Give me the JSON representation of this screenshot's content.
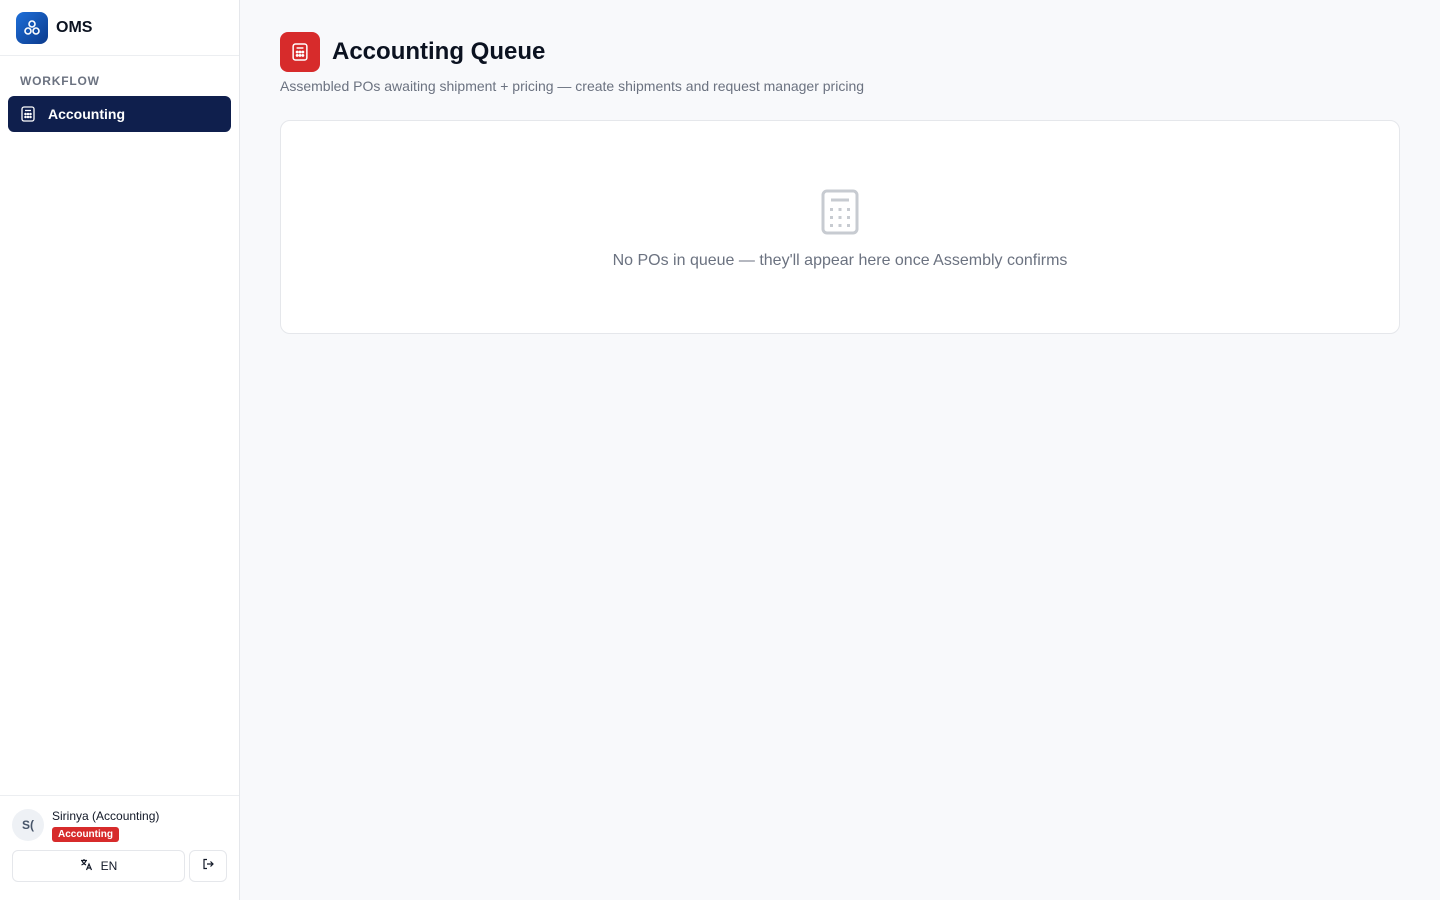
{
  "app": {
    "name": "OMS",
    "logo_icon": "cube-cluster-icon",
    "brand_color": "#1e6fd9"
  },
  "sidebar": {
    "section_label": "WORKFLOW",
    "items": [
      {
        "label": "Accounting",
        "icon": "calculator-icon",
        "active": true
      }
    ],
    "active_bg": "#0f1f4d"
  },
  "user": {
    "avatar_initials": "S(",
    "name": "Sirinya (Accounting)",
    "role_badge": "Accounting",
    "badge_color": "#d72b2b"
  },
  "footer": {
    "language_label": "EN",
    "language_icon": "translate-icon",
    "logout_icon": "logout-icon"
  },
  "page": {
    "title": "Accounting Queue",
    "subtitle": "Assembled POs awaiting shipment + pricing — create shipments and request manager pricing",
    "icon": "calculator-icon",
    "icon_color": "#d72b2b"
  },
  "empty_state": {
    "icon": "calculator-icon",
    "message": "No POs in queue — they'll appear here once Assembly confirms"
  }
}
